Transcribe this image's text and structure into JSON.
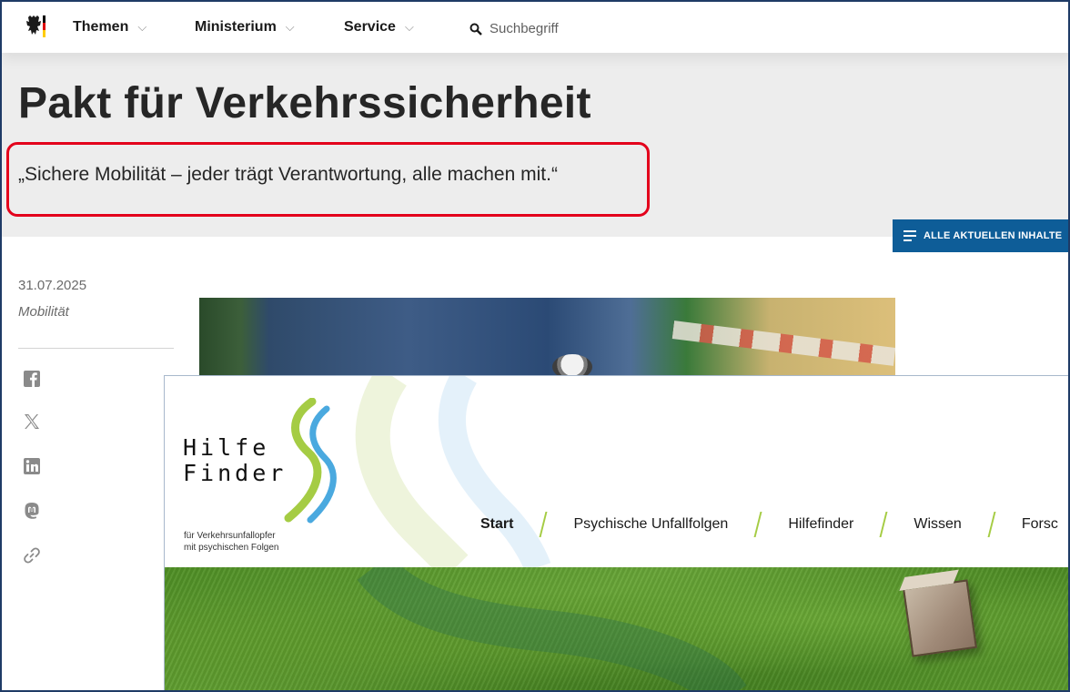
{
  "topnav": {
    "items": [
      {
        "label": "Themen",
        "chevron": "⌵"
      },
      {
        "label": "Ministerium",
        "chevron": "⌵"
      },
      {
        "label": "Service",
        "chevron": "⌵"
      }
    ],
    "search_placeholder": "Suchbegriff"
  },
  "hero": {
    "title": "Pakt für Verkehrssicherheit",
    "subtitle": "„Sichere Mobilität – jeder trägt Verantwortung, alle machen mit.“",
    "highlight_color": "#e3001b"
  },
  "toolbar": {
    "all_content_label": "ALLE AKTUELLEN INHALTE",
    "accent": "#0e5d98"
  },
  "meta": {
    "date": "31.07.2025",
    "category": "Mobilität"
  },
  "share": [
    {
      "icon": "facebook-icon"
    },
    {
      "icon": "x-icon"
    },
    {
      "icon": "linkedin-icon"
    },
    {
      "icon": "mastodon-icon"
    },
    {
      "icon": "link-icon"
    }
  ],
  "hilfefinder": {
    "logo_line1": "Hilfe",
    "logo_line2": "Finder",
    "tagline_line1": "für Verkehrsunfallopfer",
    "tagline_line2": "mit psychischen Folgen",
    "nav": [
      {
        "label": "Start",
        "active": true
      },
      {
        "label": "Psychische Unfallfolgen"
      },
      {
        "label": "Hilfefinder"
      },
      {
        "label": "Wissen"
      },
      {
        "label": "Forsc"
      }
    ],
    "accent_green": "#a5cc44",
    "accent_blue": "#4aa9df"
  }
}
